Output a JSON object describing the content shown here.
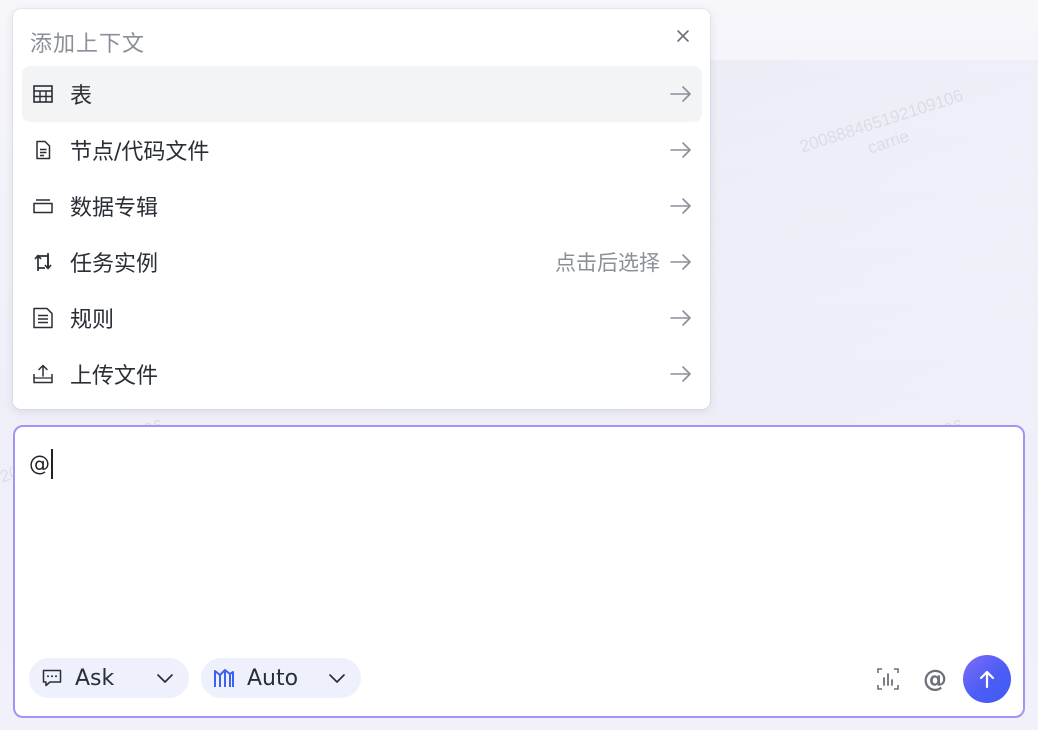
{
  "popup": {
    "title": "添加上下文",
    "items": [
      {
        "label": "表",
        "hint": "",
        "icon": "table-icon"
      },
      {
        "label": "节点/代码文件",
        "hint": "",
        "icon": "file-icon"
      },
      {
        "label": "数据专辑",
        "hint": "",
        "icon": "album-icon"
      },
      {
        "label": "任务实例",
        "hint": "点击后选择",
        "icon": "task-instance-icon"
      },
      {
        "label": "规则",
        "hint": "",
        "icon": "rules-doc-icon"
      },
      {
        "label": "上传文件",
        "hint": "",
        "icon": "upload-icon"
      }
    ]
  },
  "input": {
    "value": "@"
  },
  "toolbar": {
    "mode_label": "Ask",
    "model_label": "Auto",
    "at_label": "@"
  },
  "watermark": {
    "id": "20088846519210910​6",
    "user": "carrie"
  },
  "colors": {
    "accent_border": "#a493f4",
    "send_start": "#7f6cf9",
    "send_end": "#3f5cf4",
    "model_icon": "#3b63f0"
  }
}
